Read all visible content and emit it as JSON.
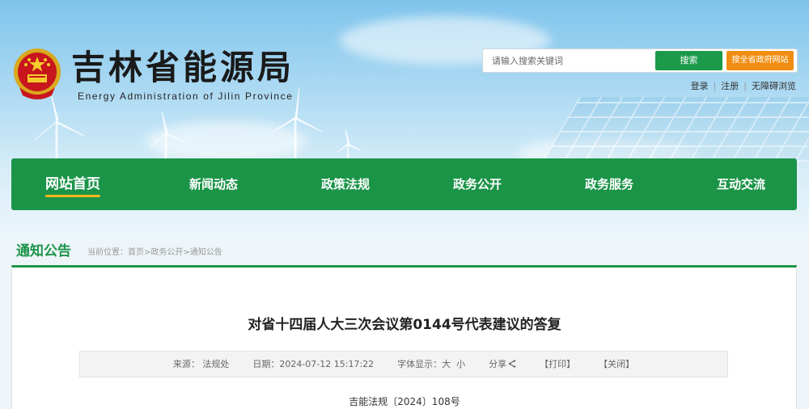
{
  "header": {
    "site_title": "吉林省能源局",
    "site_subtitle": "Energy Administration of Jilin Province",
    "emblem_icon": "national-emblem-icon",
    "search": {
      "placeholder": "请输入搜索关键词",
      "value": "",
      "search_label": "搜索",
      "search_all_label": "搜全省政府网站"
    },
    "links": {
      "login": "登录",
      "register": "注册",
      "accessible": "无障碍浏览"
    }
  },
  "nav": {
    "items": [
      {
        "label": "网站首页",
        "active": true
      },
      {
        "label": "新闻动态"
      },
      {
        "label": "政策法规"
      },
      {
        "label": "政务公开"
      },
      {
        "label": "政务服务"
      },
      {
        "label": "互动交流"
      }
    ]
  },
  "location": {
    "section_title": "通知公告",
    "prefix": "当前位置：",
    "crumbs": [
      "首页",
      "政务公开",
      "通知公告"
    ],
    "separator": ">"
  },
  "article": {
    "title": "对省十四届人大三次会议第0144号代表建议的答复",
    "meta": {
      "source_label": "来源：",
      "source": "法规处",
      "date_label": "日期：",
      "date": "2024-07-12 15:17:22",
      "font_label": "字体显示：",
      "font_large": "大",
      "font_small": "小",
      "share": "分享",
      "print": "【打印】",
      "close": "【关闭】"
    },
    "doc_number": "吉能法规〔2024〕108号"
  },
  "colors": {
    "primary_green": "#1b9448",
    "search_green": "#1a9a4a",
    "orange": "#f18d12",
    "active_underline": "#f5b81a"
  }
}
